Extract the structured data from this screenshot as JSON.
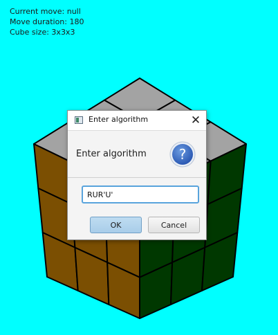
{
  "status": {
    "current_move": "Current move: null",
    "move_duration": "Move duration: 180",
    "cube_size": "Cube size: 3x3x3"
  },
  "colors": {
    "background": "#00ffff",
    "cube_top": "#a3a3a3",
    "cube_left": "#7b4f02",
    "cube_right": "#003800",
    "sticker_edge": "#000000"
  },
  "dialog": {
    "title": "Enter algorithm",
    "header": "Enter algorithm",
    "icon": "question-mark-icon",
    "question_glyph": "?",
    "close_glyph": "✕",
    "input_value": "RUR'U'",
    "ok_label": "OK",
    "cancel_label": "Cancel"
  }
}
